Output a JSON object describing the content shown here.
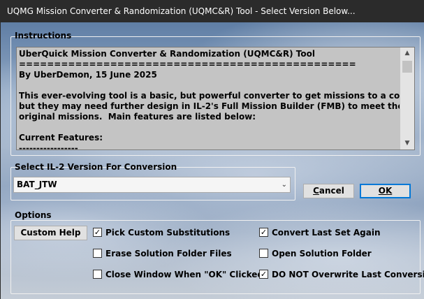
{
  "window": {
    "title": "UQMG Mission Converter & Randomization (UQMC&R) Tool - Select Version Below..."
  },
  "instructions": {
    "group_label": "Instructions",
    "lines": [
      "UberQuick Mission Converter & Randomization (UQMC&R) Tool",
      "================================================",
      "By UberDemon, 15 June 2025",
      "",
      "This ever-evolving tool is a basic, but powerful converter to get missions to a compatible state,",
      "but they may need further design in IL-2's Full Mission Builder (FMB) to meet the intent of the",
      "original missions.  Main features are listed below:",
      "",
      "Current Features:",
      "-----------------"
    ]
  },
  "version": {
    "group_label": "Select IL-2 Version For Conversion",
    "selected": "BAT_JTW"
  },
  "buttons": {
    "cancel_pre": "",
    "cancel_u": "C",
    "cancel_post": "ancel",
    "ok": "OK",
    "custom_help": "Custom Help"
  },
  "options": {
    "group_label": "Options",
    "pick_custom": {
      "label": "Pick Custom Substitutions",
      "checked": true
    },
    "erase_solution": {
      "label": "Erase Solution Folder Files",
      "checked": false
    },
    "close_window": {
      "label": "Close Window When \"OK\" Clicked",
      "checked": false
    },
    "convert_last": {
      "label": "Convert Last Set Again",
      "checked": true
    },
    "open_solution": {
      "label": "Open Solution Folder",
      "checked": false
    },
    "do_not_overwrite": {
      "label": "DO NOT Overwrite Last Conversions",
      "checked": true
    }
  }
}
